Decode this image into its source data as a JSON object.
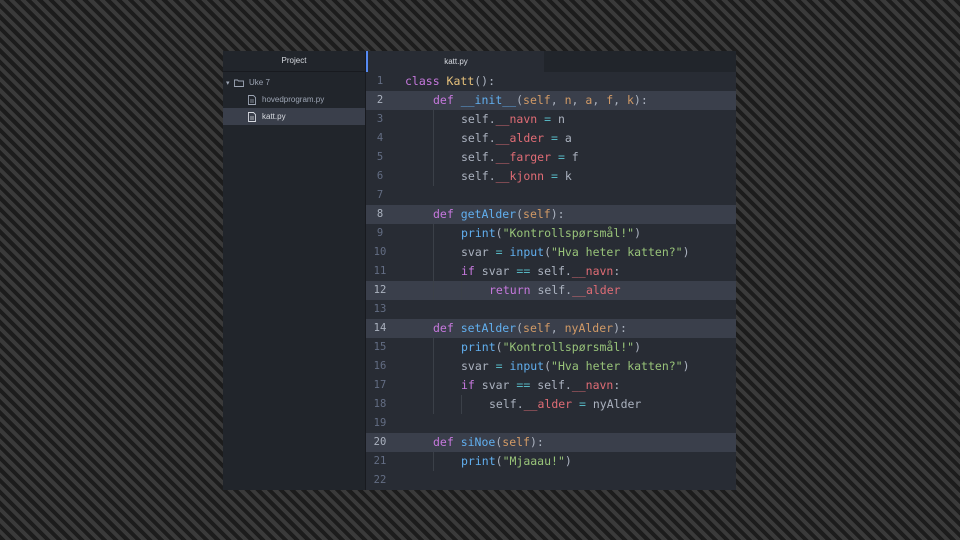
{
  "sidebar": {
    "header": "Project",
    "folder": "Uke 7",
    "files": [
      "hovedprogram.py",
      "katt.py"
    ]
  },
  "tab": {
    "label": "katt.py"
  },
  "highlighted_lines": [
    2,
    8,
    12,
    14,
    20
  ],
  "colors": {
    "keyword": "#c678dd",
    "function": "#61afef",
    "class": "#e5c07b",
    "string": "#98c379",
    "attribute": "#e06c75",
    "parameter": "#d19a66",
    "operator": "#56b6c2",
    "text": "#abb2bf"
  },
  "code": [
    {
      "n": "1",
      "indent": 0,
      "tokens": [
        [
          "kw",
          "class "
        ],
        [
          "cls",
          "Katt"
        ],
        [
          "pl",
          "():"
        ]
      ]
    },
    {
      "n": "2",
      "indent": 1,
      "tokens": [
        [
          "kw",
          "def "
        ],
        [
          "fn",
          "__init__"
        ],
        [
          "pl",
          "("
        ],
        [
          "prm",
          "self"
        ],
        [
          "pl",
          ", "
        ],
        [
          "prm",
          "n"
        ],
        [
          "pl",
          ", "
        ],
        [
          "prm",
          "a"
        ],
        [
          "pl",
          ", "
        ],
        [
          "prm",
          "f"
        ],
        [
          "pl",
          ", "
        ],
        [
          "prm",
          "k"
        ],
        [
          "pl",
          "):"
        ]
      ]
    },
    {
      "n": "3",
      "indent": 2,
      "tokens": [
        [
          "pl",
          "self."
        ],
        [
          "var",
          "__navn"
        ],
        [
          "op",
          " = "
        ],
        [
          "pl",
          "n"
        ]
      ]
    },
    {
      "n": "4",
      "indent": 2,
      "tokens": [
        [
          "pl",
          "self."
        ],
        [
          "var",
          "__alder"
        ],
        [
          "op",
          " = "
        ],
        [
          "pl",
          "a"
        ]
      ]
    },
    {
      "n": "5",
      "indent": 2,
      "tokens": [
        [
          "pl",
          "self."
        ],
        [
          "var",
          "__farger"
        ],
        [
          "op",
          " = "
        ],
        [
          "pl",
          "f"
        ]
      ]
    },
    {
      "n": "6",
      "indent": 2,
      "tokens": [
        [
          "pl",
          "self."
        ],
        [
          "var",
          "__kjonn"
        ],
        [
          "op",
          " = "
        ],
        [
          "pl",
          "k"
        ]
      ]
    },
    {
      "n": "7",
      "indent": 0,
      "tokens": []
    },
    {
      "n": "8",
      "indent": 1,
      "tokens": [
        [
          "kw",
          "def "
        ],
        [
          "fn",
          "getAlder"
        ],
        [
          "pl",
          "("
        ],
        [
          "prm",
          "self"
        ],
        [
          "pl",
          "):"
        ]
      ]
    },
    {
      "n": "9",
      "indent": 2,
      "tokens": [
        [
          "fn",
          "print"
        ],
        [
          "pl",
          "("
        ],
        [
          "str",
          "\"Kontrollspørsmål!\""
        ],
        [
          "pl",
          ")"
        ]
      ]
    },
    {
      "n": "10",
      "indent": 2,
      "tokens": [
        [
          "pl",
          "svar"
        ],
        [
          "op",
          " = "
        ],
        [
          "fn",
          "input"
        ],
        [
          "pl",
          "("
        ],
        [
          "str",
          "\"Hva heter katten?\""
        ],
        [
          "pl",
          ")"
        ]
      ]
    },
    {
      "n": "11",
      "indent": 2,
      "tokens": [
        [
          "kw",
          "if "
        ],
        [
          "pl",
          "svar"
        ],
        [
          "op",
          " == "
        ],
        [
          "pl",
          "self."
        ],
        [
          "var",
          "__navn"
        ],
        [
          "pl",
          ":"
        ]
      ]
    },
    {
      "n": "12",
      "indent": 3,
      "tokens": [
        [
          "kw",
          "return "
        ],
        [
          "pl",
          "self."
        ],
        [
          "var",
          "__alder"
        ]
      ]
    },
    {
      "n": "13",
      "indent": 0,
      "tokens": []
    },
    {
      "n": "14",
      "indent": 1,
      "tokens": [
        [
          "kw",
          "def "
        ],
        [
          "fn",
          "setAlder"
        ],
        [
          "pl",
          "("
        ],
        [
          "prm",
          "self"
        ],
        [
          "pl",
          ", "
        ],
        [
          "prm",
          "nyAlder"
        ],
        [
          "pl",
          "):"
        ]
      ]
    },
    {
      "n": "15",
      "indent": 2,
      "tokens": [
        [
          "fn",
          "print"
        ],
        [
          "pl",
          "("
        ],
        [
          "str",
          "\"Kontrollspørsmål!\""
        ],
        [
          "pl",
          ")"
        ]
      ]
    },
    {
      "n": "16",
      "indent": 2,
      "tokens": [
        [
          "pl",
          "svar"
        ],
        [
          "op",
          " = "
        ],
        [
          "fn",
          "input"
        ],
        [
          "pl",
          "("
        ],
        [
          "str",
          "\"Hva heter katten?\""
        ],
        [
          "pl",
          ")"
        ]
      ]
    },
    {
      "n": "17",
      "indent": 2,
      "tokens": [
        [
          "kw",
          "if "
        ],
        [
          "pl",
          "svar"
        ],
        [
          "op",
          " == "
        ],
        [
          "pl",
          "self."
        ],
        [
          "var",
          "__navn"
        ],
        [
          "pl",
          ":"
        ]
      ]
    },
    {
      "n": "18",
      "indent": 3,
      "tokens": [
        [
          "pl",
          "self."
        ],
        [
          "var",
          "__alder"
        ],
        [
          "op",
          " = "
        ],
        [
          "pl",
          "nyAlder"
        ]
      ]
    },
    {
      "n": "19",
      "indent": 0,
      "tokens": []
    },
    {
      "n": "20",
      "indent": 1,
      "tokens": [
        [
          "kw",
          "def "
        ],
        [
          "fn",
          "siNoe"
        ],
        [
          "pl",
          "("
        ],
        [
          "prm",
          "self"
        ],
        [
          "pl",
          "):"
        ]
      ]
    },
    {
      "n": "21",
      "indent": 2,
      "tokens": [
        [
          "fn",
          "print"
        ],
        [
          "pl",
          "("
        ],
        [
          "str",
          "\"Mjaaau!\""
        ],
        [
          "pl",
          ")"
        ]
      ]
    },
    {
      "n": "22",
      "indent": 0,
      "tokens": []
    }
  ]
}
